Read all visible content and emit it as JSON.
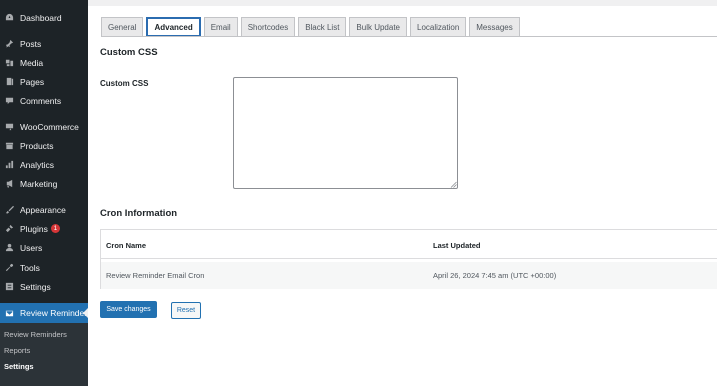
{
  "sidebar": {
    "items": [
      {
        "label": "Dashboard",
        "icon": "dashboard-icon"
      },
      {
        "label": "Posts",
        "icon": "pin-icon"
      },
      {
        "label": "Media",
        "icon": "media-icon"
      },
      {
        "label": "Pages",
        "icon": "pages-icon"
      },
      {
        "label": "Comments",
        "icon": "comment-icon"
      },
      {
        "label": "WooCommerce",
        "icon": "woocommerce-icon"
      },
      {
        "label": "Products",
        "icon": "products-icon"
      },
      {
        "label": "Analytics",
        "icon": "analytics-icon"
      },
      {
        "label": "Marketing",
        "icon": "megaphone-icon"
      },
      {
        "label": "Appearance",
        "icon": "brush-icon"
      },
      {
        "label": "Plugins",
        "icon": "plugin-icon",
        "badge": "1"
      },
      {
        "label": "Users",
        "icon": "users-icon"
      },
      {
        "label": "Tools",
        "icon": "wrench-icon"
      },
      {
        "label": "Settings",
        "icon": "settings-icon"
      },
      {
        "label": "Review Reminder",
        "icon": "email-icon"
      }
    ],
    "submenu": [
      "Review Reminders",
      "Reports",
      "Settings"
    ]
  },
  "tabs": [
    "General",
    "Advanced",
    "Email",
    "Shortcodes",
    "Black List",
    "Bulk Update",
    "Localization",
    "Messages"
  ],
  "active_tab": "Advanced",
  "custom_css": {
    "section_title": "Custom CSS",
    "field_label": "Custom CSS",
    "value": ""
  },
  "cron": {
    "section_title": "Cron Information",
    "headers": [
      "Cron Name",
      "Last Updated"
    ],
    "rows": [
      [
        "Review Reminder Email Cron",
        "April 26, 2024 7:45 am (UTC +00:00)"
      ]
    ]
  },
  "buttons": {
    "save": "Save changes",
    "reset": "Reset"
  },
  "colors": {
    "sidebar_bg": "#1d2327",
    "accent": "#2271b1",
    "badge": "#d63638"
  }
}
